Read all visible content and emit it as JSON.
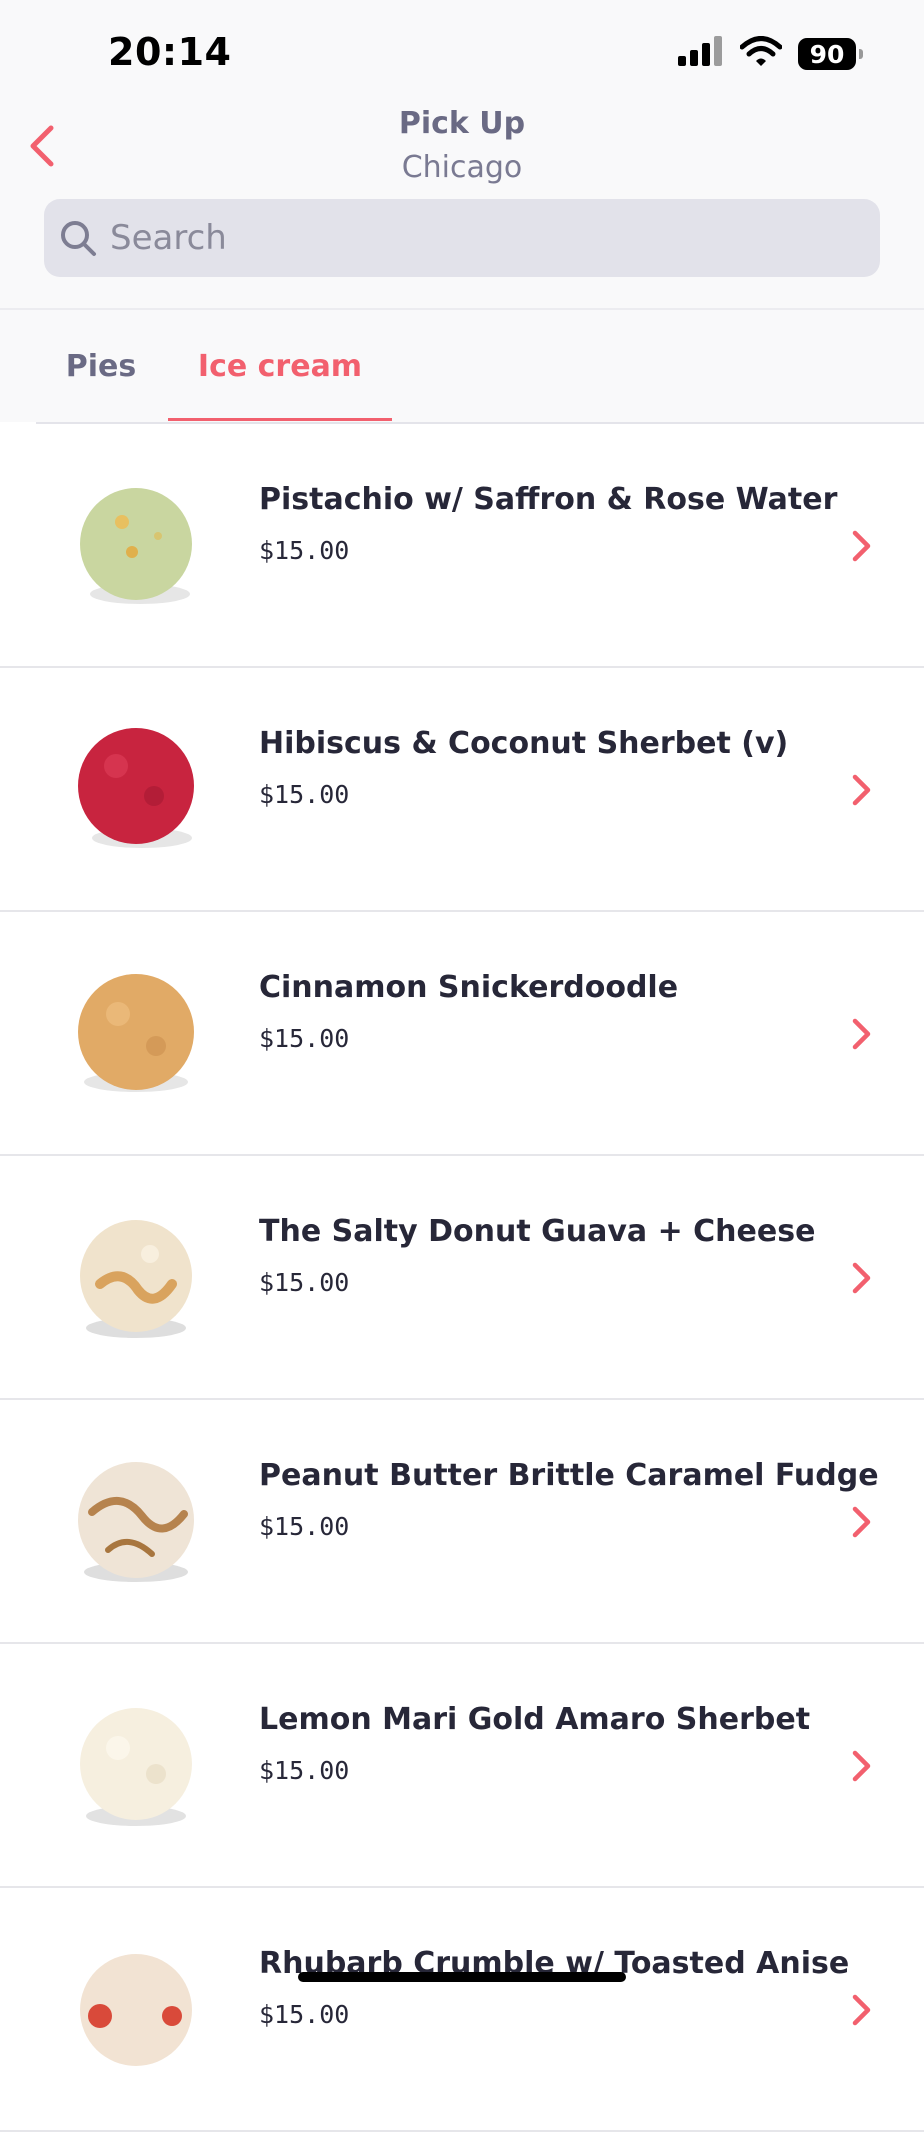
{
  "status_bar": {
    "time": "20:14",
    "battery": "90",
    "icons": [
      "signal-icon",
      "wifi-icon",
      "battery-icon"
    ]
  },
  "header": {
    "title": "Pick Up",
    "subtitle": "Chicago",
    "back_icon": "chevron-left-icon"
  },
  "search": {
    "placeholder": "Search",
    "value": ""
  },
  "tabs": [
    {
      "label": "Pies",
      "active": false
    },
    {
      "label": "Ice cream",
      "active": true
    }
  ],
  "items": [
    {
      "name": "Pistachio w/ Saffron & Rose Water",
      "price": "$15.00",
      "scoop_color": "#c9d6a0"
    },
    {
      "name": "Hibiscus & Coconut Sherbet (v)",
      "price": "$15.00",
      "scoop_color": "#c8243f"
    },
    {
      "name": "Cinnamon Snickerdoodle",
      "price": "$15.00",
      "scoop_color": "#e1aa66"
    },
    {
      "name": "The Salty Donut Guava + Cheese",
      "price": "$15.00",
      "scoop_color": "#f0e3cc"
    },
    {
      "name": "Peanut Butter Brittle Caramel Fudge",
      "price": "$15.00",
      "scoop_color": "#efe4d6"
    },
    {
      "name": "Lemon Mari Gold Amaro Sherbet",
      "price": "$15.00",
      "scoop_color": "#f6efdf"
    },
    {
      "name": "Rhubarb Crumble w/ Toasted Anise",
      "price": "$15.00",
      "scoop_color": "#f2e3d3"
    }
  ],
  "colors": {
    "accent": "#f2606e",
    "text_dark": "#272738",
    "text_muted": "#6a6a84",
    "search_bg": "#e2e2ea"
  }
}
